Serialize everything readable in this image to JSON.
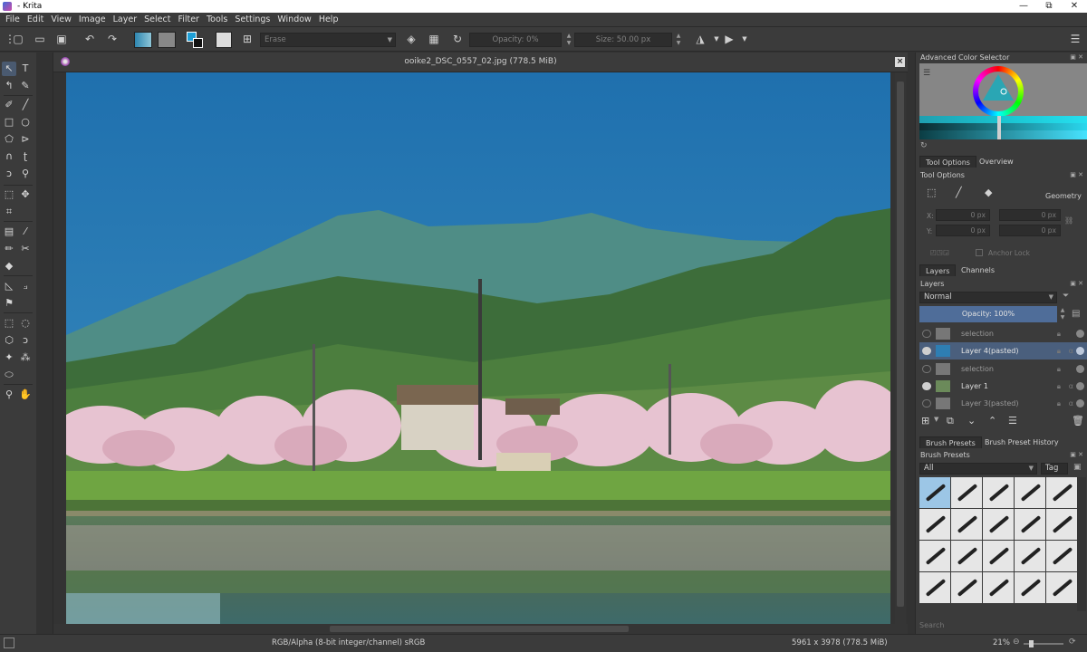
{
  "window": {
    "title": " - Krita",
    "controls": {
      "minimize": "—",
      "restore": "⧉",
      "close": "✕"
    }
  },
  "menu": [
    "File",
    "Edit",
    "View",
    "Image",
    "Layer",
    "Select",
    "Filter",
    "Tools",
    "Settings",
    "Window",
    "Help"
  ],
  "toolbar": {
    "blend_mode": "Erase",
    "opacity": "Opacity: 0%",
    "size": "Size: 50.00 px"
  },
  "document": {
    "title": "ooike2_DSC_0557_02.jpg (778.5 MiB)"
  },
  "dockers": {
    "color_selector": {
      "title": "Advanced Color Selector"
    },
    "tool_options": {
      "tabs": [
        "Tool Options",
        "Overview"
      ],
      "title": "Tool Options",
      "geometry_label": "Geometry",
      "x_label": "X:",
      "y_label": "Y:",
      "x1": "0 px",
      "x2": "0 px",
      "y1": "0 px",
      "y2": "0 px",
      "anchor_lock": "Anchor Lock"
    },
    "layers": {
      "tabs": [
        "Layers",
        "Channels"
      ],
      "title": "Layers",
      "blend_mode": "Normal",
      "opacity": "Opacity: 100%",
      "items": [
        {
          "name": "selection",
          "visible": false,
          "selected": false
        },
        {
          "name": "Layer 4(pasted)",
          "visible": true,
          "selected": true
        },
        {
          "name": "selection",
          "visible": false,
          "selected": false
        },
        {
          "name": "Layer 1",
          "visible": true,
          "selected": false
        },
        {
          "name": "Layer 3(pasted)",
          "visible": false,
          "selected": false
        }
      ]
    },
    "brush_presets": {
      "tabs": [
        "Brush Presets",
        "Brush Preset History"
      ],
      "title": "Brush Presets",
      "filter": "All",
      "tag_label": "Tag",
      "search_placeholder": "Search"
    }
  },
  "status": {
    "color_space": "RGB/Alpha (8-bit integer/channel)  sRGB",
    "image_size": "5961 x 3978 (778.5 MiB)",
    "zoom": "21%"
  },
  "colors": {
    "sky": "#2b79b8",
    "selection": "#4a5f7d",
    "panel": "#3b3b3b"
  }
}
